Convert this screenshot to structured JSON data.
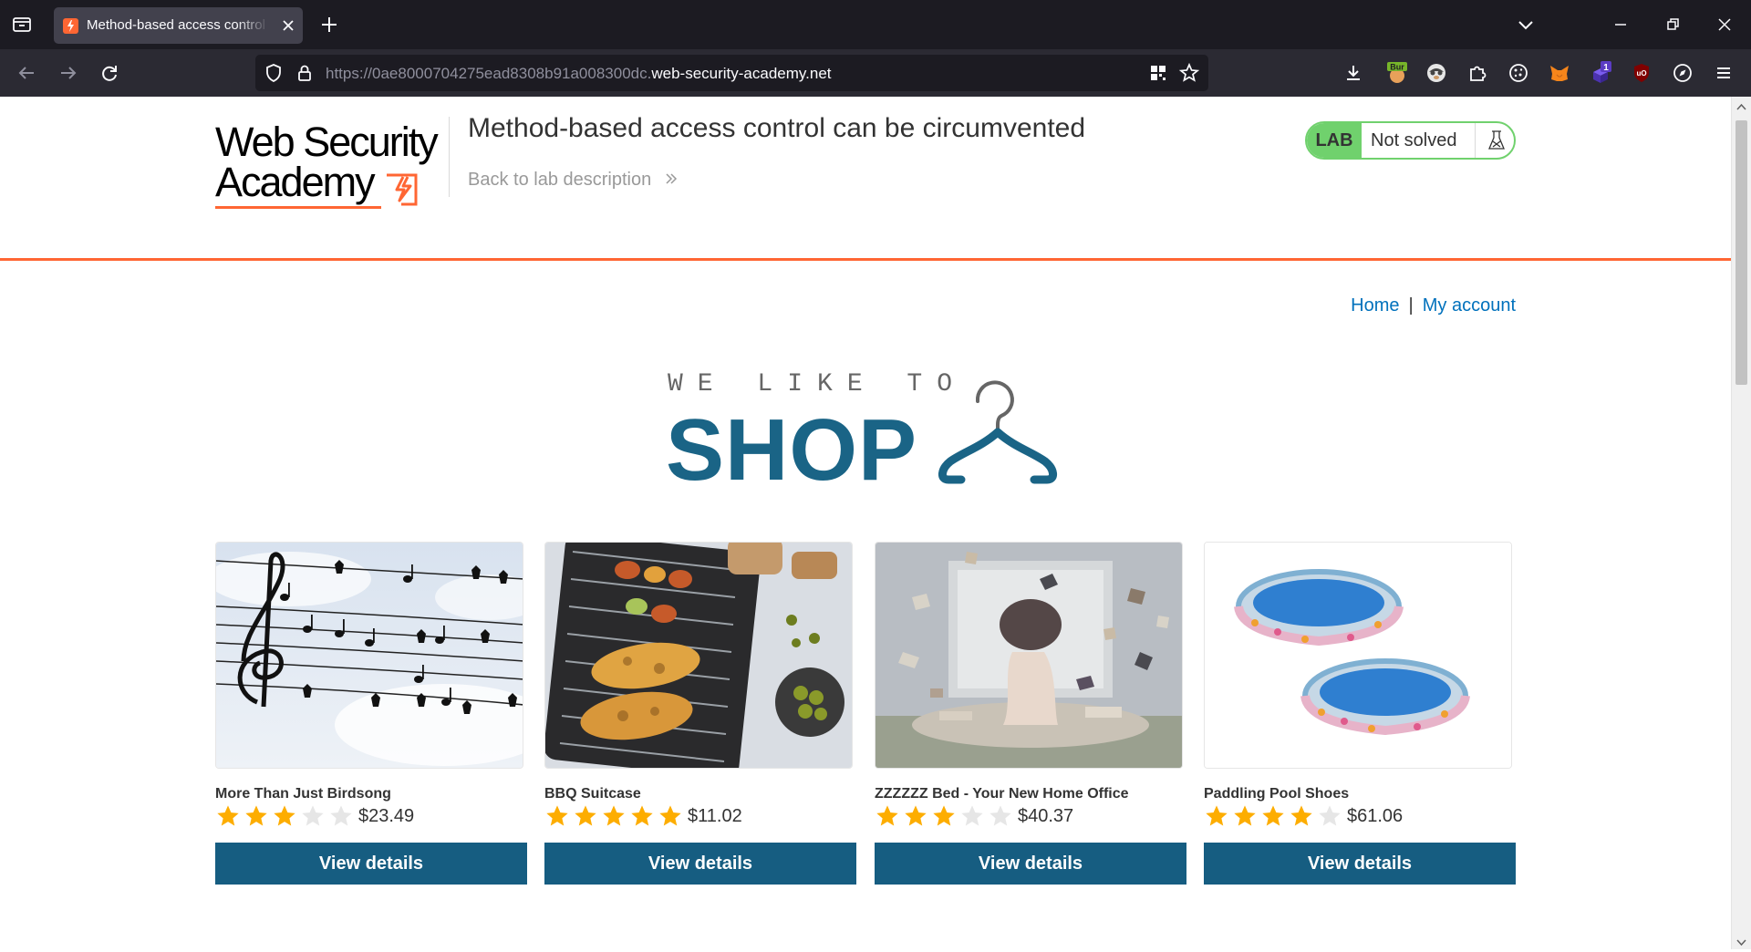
{
  "browser": {
    "tab": {
      "title": "Method-based access control can be circumvented"
    },
    "url": {
      "prefix": "https://0ae8000704275ead8308b91a008300dc.",
      "domain": "web-security-academy.net"
    },
    "extensions": [
      {
        "icon": "burp-extension-icon",
        "label": "Bur",
        "color": "#77b52a"
      },
      {
        "icon": "privacy-badger-icon",
        "color": "#555555"
      },
      {
        "icon": "puzzle-extension-icon",
        "color": "#fbfbfe"
      },
      {
        "icon": "cookie-editor-icon",
        "color": "#fbfbfe"
      },
      {
        "icon": "metamask-fox-icon",
        "color": "#f6851b"
      },
      {
        "icon": "purple-extension-icon",
        "label": "1",
        "color": "#5b3cc4"
      },
      {
        "icon": "ublock-origin-icon",
        "label": "uO",
        "color": "#800000"
      },
      {
        "icon": "compass-extension-icon",
        "color": "#fbfbfe"
      }
    ]
  },
  "header": {
    "logo_line1": "Web Security",
    "logo_line2": "Academy",
    "lab_title": "Method-based access control can be circumvented",
    "back_link": "Back to lab description",
    "lab_badge": "LAB",
    "lab_status": "Not solved"
  },
  "nav": {
    "home": "Home",
    "separator": "|",
    "my_account": "My account"
  },
  "banner": {
    "line1": "WE LIKE TO",
    "line2": "SHOP"
  },
  "colors": {
    "accent": "#ff6633",
    "button": "#165d81",
    "link": "#0071bc",
    "star": "#fdad00",
    "lab_green": "#70d16d"
  },
  "products": [
    {
      "name": "More Than Just Birdsong",
      "rating": 3,
      "price": "$23.49",
      "button": "View details",
      "image": "birdsong-music-image"
    },
    {
      "name": "BBQ Suitcase",
      "rating": 5,
      "price": "$11.02",
      "button": "View details",
      "image": "bbq-grill-image"
    },
    {
      "name": "ZZZZZZ Bed - Your New Home Office",
      "rating": 3,
      "price": "$40.37",
      "button": "View details",
      "image": "bed-books-image"
    },
    {
      "name": "Paddling Pool Shoes",
      "rating": 4,
      "price": "$61.06",
      "button": "View details",
      "image": "paddling-pools-image"
    }
  ]
}
